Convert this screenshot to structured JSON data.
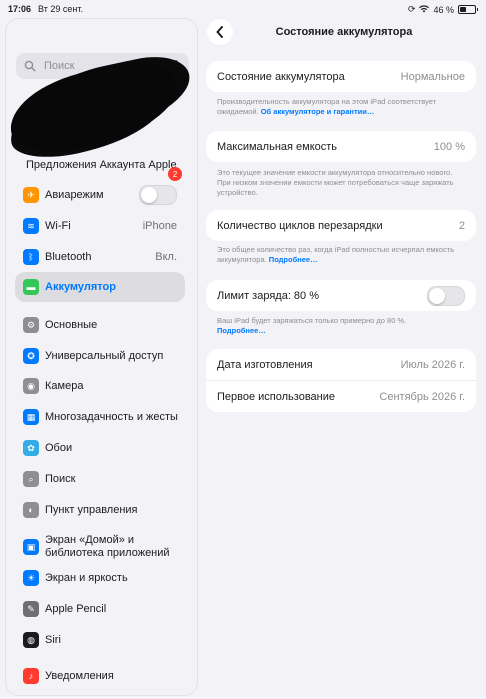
{
  "status": {
    "time": "17:06",
    "date": "Вт 29 сент.",
    "battery_text": "46 %",
    "battery_level": 0.46
  },
  "sidebar": {
    "search_placeholder": "Поиск",
    "promo": {
      "label": "Предложения Аккаунта Apple",
      "badge": "2"
    },
    "items": [
      {
        "label": "Авиарежим",
        "icon": "airplane-icon",
        "color": "#ff9500",
        "toggle": false
      },
      {
        "label": "Wi-Fi",
        "icon": "wifi-icon",
        "color": "#007aff",
        "value": "iPhone"
      },
      {
        "label": "Bluetooth",
        "icon": "bluetooth-icon",
        "color": "#007aff",
        "value": "Вкл."
      },
      {
        "label": "Аккумулятор",
        "icon": "battery-icon",
        "color": "#34c759",
        "selected": true
      },
      {
        "label": "Основные",
        "icon": "gear-icon",
        "color": "#8e8e93"
      },
      {
        "label": "Универсальный доступ",
        "icon": "accessibility-icon",
        "color": "#007aff"
      },
      {
        "label": "Камера",
        "icon": "camera-icon",
        "color": "#8e8e93"
      },
      {
        "label": "Многозадачность и жесты",
        "icon": "multitasking-icon",
        "color": "#007aff"
      },
      {
        "label": "Обои",
        "icon": "wallpaper-icon",
        "color": "#32ade6"
      },
      {
        "label": "Поиск",
        "icon": "search-icon",
        "color": "#8e8e93"
      },
      {
        "label": "Пункт управления",
        "icon": "control-center-icon",
        "color": "#8e8e93"
      },
      {
        "label": "Экран «Домой» и библиотека приложений",
        "icon": "home-screen-icon",
        "color": "#007aff"
      },
      {
        "label": "Экран и яркость",
        "icon": "brightness-icon",
        "color": "#007aff"
      },
      {
        "label": "Apple Pencil",
        "icon": "pencil-icon",
        "color": "#6e6e73"
      },
      {
        "label": "Siri",
        "icon": "siri-icon",
        "color": "#1c1c1e"
      },
      {
        "label": "Уведомления",
        "icon": "notifications-icon",
        "color": "#ff3b30"
      }
    ]
  },
  "detail": {
    "title": "Состояние аккумулятора",
    "health": {
      "label": "Состояние аккумулятора",
      "value": "Нормальное"
    },
    "health_desc": "Производительность аккумулятора на этом iPad соответствует ожидаемой.",
    "health_link": "Об аккумуляторе и гарантии…",
    "capacity": {
      "label": "Максимальная емкость",
      "value": "100 %"
    },
    "capacity_desc": "Это текущее значение емкости аккумулятора относительно нового. При низком значении емкости может потребоваться чаще заряжать устройство.",
    "cycles": {
      "label": "Количество циклов перезарядки",
      "value": "2"
    },
    "cycles_desc": "Это общее количество раз, когда iPad полностью исчерпал емкость аккумулятора.",
    "cycles_link": "Подробнее…",
    "limit": {
      "label": "Лимит заряда: 80 %",
      "toggle": false
    },
    "limit_desc": "Ваш iPad будет заряжаться только примерно до 80 %.",
    "limit_link": "Подробнее…",
    "manufacture": {
      "label": "Дата изготовления",
      "value": "Июль 2026 г."
    },
    "first_use": {
      "label": "Первое использование",
      "value": "Сентябрь 2026 г."
    }
  }
}
